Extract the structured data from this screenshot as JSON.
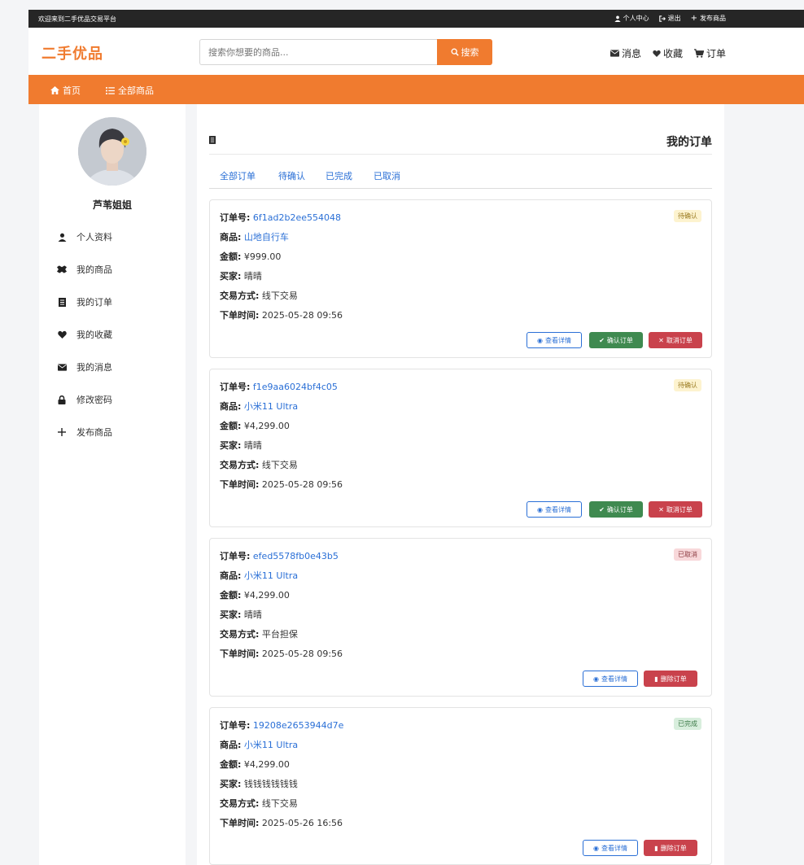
{
  "topbar": {
    "welcome": "欢迎来到二手优品交易平台",
    "profile": "个人中心",
    "logout": "退出",
    "publish": "发布商品"
  },
  "header": {
    "logo": "二手优品",
    "search_placeholder": "搜索你想要的商品...",
    "search_btn": "搜索",
    "messages": "消息",
    "favorites": "收藏",
    "orders": "订单"
  },
  "nav": {
    "home": "首页",
    "all_goods": "全部商品"
  },
  "sidebar": {
    "username": "芦苇姐姐",
    "items": [
      {
        "label": "个人资料",
        "icon": "user-icon"
      },
      {
        "label": "我的商品",
        "icon": "boxes-icon"
      },
      {
        "label": "我的订单",
        "icon": "receipt-icon"
      },
      {
        "label": "我的收藏",
        "icon": "heart-icon"
      },
      {
        "label": "我的消息",
        "icon": "envelope-icon"
      },
      {
        "label": "修改密码",
        "icon": "lock-icon"
      },
      {
        "label": "发布商品",
        "icon": "plus-icon"
      }
    ]
  },
  "main": {
    "title": "我的订单",
    "tabs": [
      "全部订单",
      "待确认",
      "已完成",
      "已取消"
    ],
    "labels": {
      "order_no": "订单号:",
      "product": "商品:",
      "amount": "金额:",
      "buyer": "买家:",
      "trade": "交易方式:",
      "time": "下单时间:"
    },
    "buttons": {
      "view": "查看详情",
      "confirm": "确认订单",
      "cancel": "取消订单",
      "delete": "删除订单"
    },
    "orders": [
      {
        "order_no": "6f1ad2b2ee554048",
        "product": "山地自行车",
        "amount": "¥999.00",
        "buyer": "晴晴",
        "trade": "线下交易",
        "time": "2025-05-28 09:56",
        "status": "待确认"
      },
      {
        "order_no": "f1e9aa6024bf4c05",
        "product": "小米11 Ultra",
        "amount": "¥4,299.00",
        "buyer": "晴晴",
        "trade": "线下交易",
        "time": "2025-05-28 09:56",
        "status": "待确认"
      },
      {
        "order_no": "efed5578fb0e43b5",
        "product": "小米11 Ultra",
        "amount": "¥4,299.00",
        "buyer": "晴晴",
        "trade": "平台担保",
        "time": "2025-05-28 09:56",
        "status": "已取消"
      },
      {
        "order_no": "19208e2653944d7e",
        "product": "小米11 Ultra",
        "amount": "¥4,299.00",
        "buyer": "钱钱钱钱钱钱",
        "trade": "线下交易",
        "time": "2025-05-26 16:56",
        "status": "已完成"
      }
    ]
  },
  "colors": {
    "brand": "#f07b2f",
    "link": "#2a6fd6",
    "confirm": "#3f8a50",
    "danger": "#c9424c"
  }
}
